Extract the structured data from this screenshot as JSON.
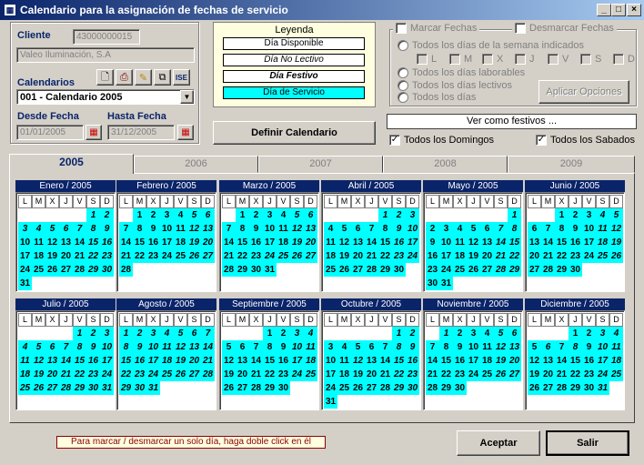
{
  "window": {
    "title": "Calendario para la asignación de fechas de servicio"
  },
  "cliente": {
    "label": "Cliente",
    "code": "43000000015",
    "name": "Valeo Iluminación, S.A"
  },
  "calendarios": {
    "label": "Calendarios",
    "selected": "001 - Calendario 2005"
  },
  "desde": {
    "label": "Desde Fecha",
    "value": "01/01/2005"
  },
  "hasta": {
    "label": "Hasta Fecha",
    "value": "31/12/2005"
  },
  "leyenda": {
    "title": "Leyenda",
    "items": [
      "Día Disponible",
      "Día No Lectivo",
      "Día Festivo",
      "Día de Servicio"
    ]
  },
  "definir_button": "Definir Calendario",
  "options": {
    "marcar": "Marcar Fechas",
    "desmarcar": "Desmarcar Fechas",
    "radio1": "Todos los días de la semana indicados",
    "days": [
      "L",
      "M",
      "X",
      "J",
      "V",
      "S",
      "D"
    ],
    "radio2": "Todos los días laborables",
    "radio3": "Todos los días lectivos",
    "radio4": "Todos los días",
    "aplicar": "Aplicar Opciones"
  },
  "festivos_label": "Ver como festivos ...",
  "domingos_label": "Todos los Domingos",
  "sabados_label": "Todos los Sabados",
  "tabs": [
    "2005",
    "2006",
    "2007",
    "2008",
    "2009"
  ],
  "weekday_headers": [
    "L",
    "M",
    "X",
    "J",
    "V",
    "S",
    "D"
  ],
  "months": [
    {
      "name": "Enero / 2005",
      "offset": 5,
      "days": 31,
      "festivos": [
        1,
        2,
        3,
        4,
        5,
        6,
        7,
        8,
        9,
        15,
        16,
        22,
        23,
        29,
        30
      ]
    },
    {
      "name": "Febrero / 2005",
      "offset": 1,
      "days": 28,
      "festivos": [
        5,
        6,
        12,
        13,
        19,
        20,
        26,
        27
      ]
    },
    {
      "name": "Marzo / 2005",
      "offset": 1,
      "days": 31,
      "festivos": [
        5,
        6,
        12,
        13,
        19,
        20,
        24,
        25,
        26,
        27
      ]
    },
    {
      "name": "Abril / 2005",
      "offset": 4,
      "days": 30,
      "festivos": [
        1,
        2,
        3,
        9,
        10,
        16,
        17,
        23,
        24
      ]
    },
    {
      "name": "Mayo / 2005",
      "offset": 6,
      "days": 31,
      "festivos": [
        1,
        7,
        8,
        14,
        15,
        21,
        22,
        28,
        29
      ]
    },
    {
      "name": "Junio / 2005",
      "offset": 2,
      "days": 30,
      "festivos": [
        4,
        5,
        11,
        12,
        18,
        19,
        25,
        26
      ]
    },
    {
      "name": "Julio / 2005",
      "offset": 4,
      "days": 31,
      "festivos": [
        1,
        2,
        3,
        4,
        5,
        6,
        7,
        8,
        9,
        10,
        11,
        12,
        13,
        14,
        15,
        16,
        17,
        18,
        19,
        20,
        21,
        22,
        23,
        24,
        25,
        26,
        27,
        28,
        29,
        30,
        31
      ]
    },
    {
      "name": "Agosto / 2005",
      "offset": 0,
      "days": 31,
      "festivos": [
        1,
        2,
        3,
        4,
        5,
        6,
        7,
        8,
        9,
        10,
        11,
        12,
        13,
        14,
        15,
        16,
        17,
        18,
        19,
        20,
        21,
        22,
        23,
        24,
        25,
        26,
        27,
        28,
        29,
        30,
        31
      ]
    },
    {
      "name": "Septiembre / 2005",
      "offset": 3,
      "days": 30,
      "festivos": [
        3,
        4,
        10,
        11,
        17,
        18,
        24,
        25
      ]
    },
    {
      "name": "Octubre / 2005",
      "offset": 5,
      "days": 31,
      "festivos": [
        1,
        2,
        8,
        9,
        12,
        15,
        16,
        22,
        23,
        29,
        30
      ]
    },
    {
      "name": "Noviembre / 2005",
      "offset": 1,
      "days": 30,
      "festivos": [
        1,
        5,
        6,
        12,
        13,
        19,
        20,
        26,
        27
      ]
    },
    {
      "name": "Diciembre / 2005",
      "offset": 3,
      "days": 31,
      "festivos": [
        3,
        4,
        6,
        8,
        10,
        11,
        17,
        18,
        24,
        25,
        31
      ]
    }
  ],
  "status_hint": "Para marcar / desmarcar un solo día, haga doble click en él",
  "aceptar": "Aceptar",
  "salir": "Salir"
}
